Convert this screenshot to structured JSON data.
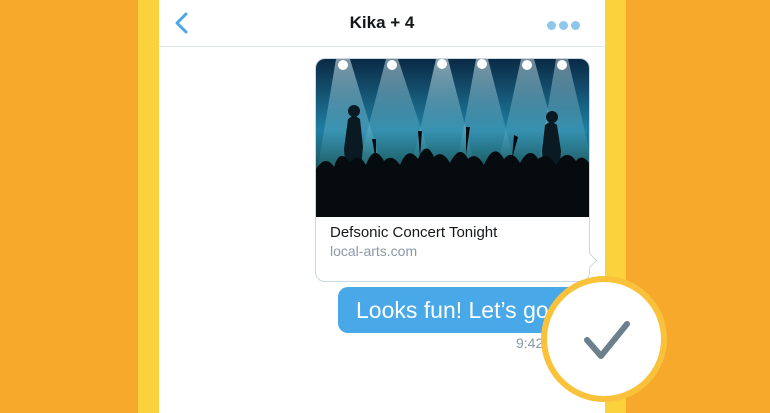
{
  "header": {
    "title": "Kika + 4",
    "back_icon": "chevron-left-icon",
    "more_icon": "more-dots-icon"
  },
  "link_card": {
    "title": "Defsonic Concert Tonight",
    "domain": "local-arts.com",
    "image": "concert-crowd-image"
  },
  "message": {
    "text": "Looks fun! Let’s go",
    "timestamp": "9:42 AM"
  },
  "badge": {
    "icon": "checkmark-icon"
  },
  "colors": {
    "background": "#f6a92a",
    "frame": "#f9d23c",
    "accent": "#49a8e8",
    "muted": "#8b98a5"
  }
}
